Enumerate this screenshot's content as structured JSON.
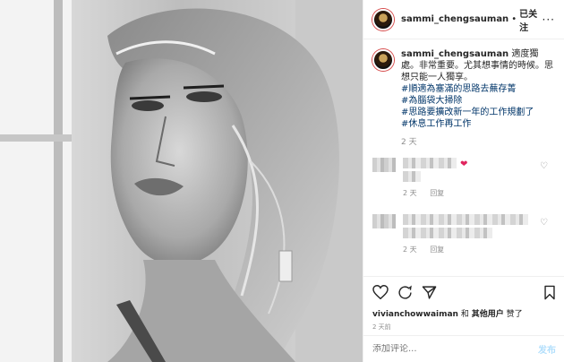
{
  "header": {
    "username": "sammi_chengsauman",
    "separator": "•",
    "follow_status": "已关注",
    "more": "···"
  },
  "caption": {
    "username": "sammi_chengsauman",
    "text": "適度獨處。非常重要。尤其想事情的時候。思想只能一人獨享。",
    "hashtags": [
      "#順適為塞滿的思路去蕪存菁",
      "#為腦袋大掃除",
      "#思路要擴改新一年的工作規劃了",
      "#休息工作再工作"
    ],
    "age": "2 天"
  },
  "comments": [
    {
      "age": "2 天",
      "reply": "回复"
    },
    {
      "age": "2 天",
      "reply": "回复"
    }
  ],
  "likes": {
    "user": "vivianchowwaiman",
    "conj": "和",
    "others": "其他用户",
    "suffix": "赞了"
  },
  "timestamp": "2 天前",
  "add_comment": {
    "placeholder": "添加评论...",
    "post_label": "发布"
  },
  "icons": {
    "like": "heart-icon",
    "comment": "comment-icon",
    "share": "share-icon",
    "save": "bookmark-icon"
  },
  "colors": {
    "hashtag": "#003569",
    "muted": "#8e8e8e",
    "post_button": "#b2dffc",
    "heart": "#e0245e"
  }
}
